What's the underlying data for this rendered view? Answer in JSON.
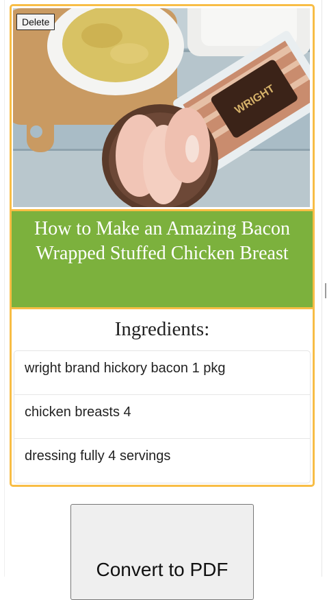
{
  "recipe": {
    "delete_label": "Delete",
    "title": "How to Make an Amazing Bacon Wrapped Stuffed Chicken Breast",
    "photo_brand_text": "WRIGHT"
  },
  "ingredients": {
    "heading": "Ingredients:",
    "items": [
      "wright brand hickory bacon 1 pkg",
      "chicken breasts 4",
      "dressing fully 4 servings"
    ]
  },
  "actions": {
    "convert_label": "Convert to PDF"
  },
  "colors": {
    "card_border": "#f8bd45",
    "title_band": "#7cb13d",
    "title_text": "#ffffff"
  }
}
